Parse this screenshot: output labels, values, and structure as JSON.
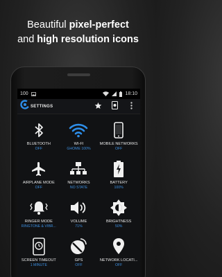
{
  "headline": {
    "line1_prefix": "Beautiful ",
    "line1_bold": "pixel-perfect",
    "line2_prefix": "and ",
    "line2_bold": "high resolution icons"
  },
  "status_bar": {
    "left": "100",
    "time": "18:10"
  },
  "app": {
    "title": "SETTINGS"
  },
  "tiles": [
    {
      "label": "BLUETOOTH",
      "status": "OFF",
      "icon": "bluetooth-icon"
    },
    {
      "label": "WI-FI",
      "status": "GHOME 100%",
      "icon": "wifi-icon"
    },
    {
      "label": "MOBILE NETWORKS",
      "status": "OFF",
      "icon": "phone-icon"
    },
    {
      "label": "AIRPLANE MODE",
      "status": "OFF",
      "icon": "airplane-icon"
    },
    {
      "label": "NETWORKS",
      "status": "NO STATE",
      "icon": "network-icon"
    },
    {
      "label": "BATTERY",
      "status": "100%",
      "icon": "battery-icon"
    },
    {
      "label": "RINGER MODE",
      "status": "RINGTONE & VIBR...",
      "icon": "ringer-icon"
    },
    {
      "label": "VOLUME",
      "status": "71%",
      "icon": "volume-icon"
    },
    {
      "label": "BRIGHTNESS",
      "status": "50%",
      "icon": "brightness-icon"
    },
    {
      "label": "SCREEN TIMEOUT",
      "status": "1 MINUTE",
      "icon": "timeout-icon"
    },
    {
      "label": "GPS",
      "status": "OFF",
      "icon": "gps-icon"
    },
    {
      "label": "NETWORK LOCATI...",
      "status": "OFF",
      "icon": "location-icon"
    }
  ],
  "colors": {
    "accent": "#2d8de8",
    "status": "#3d8fe0"
  }
}
